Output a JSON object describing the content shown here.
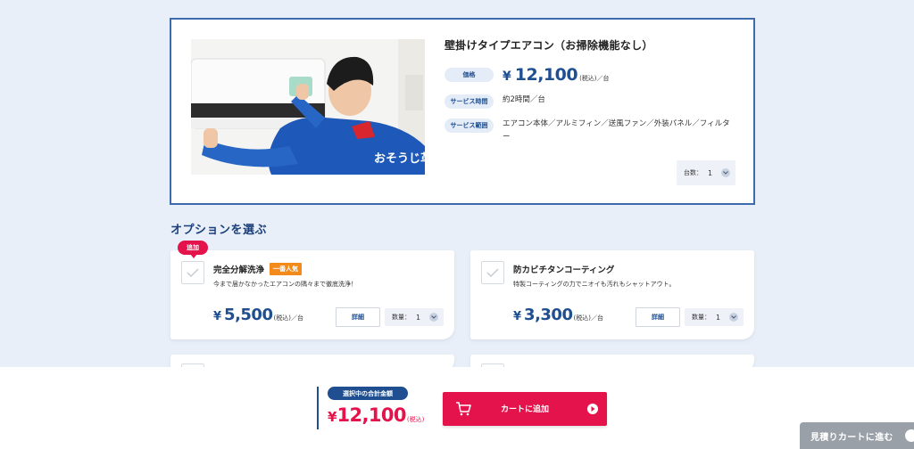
{
  "product": {
    "title": "壁掛けタイプエアコン（お掃除機能なし）",
    "price_label": "価格",
    "price_yen": "¥",
    "price_value": "12,100",
    "price_suffix": "(税込)／台",
    "time_label": "サービス時間",
    "time_value": "約2時間／台",
    "scope_label": "サービス範囲",
    "scope_value": "エアコン本体／アルミフィン／送風ファン／外装パネル／フィルター",
    "qty_label": "台数：",
    "qty_value": "1",
    "photo_text": "おそうじ革命"
  },
  "options_title": "オプションを選ぶ",
  "add_tag": "追加",
  "options": [
    {
      "name": "完全分解洗浄",
      "badge": "一番人気",
      "desc": "今まで届かなかったエアコンの隅々まで徹底洗浄！",
      "yen": "¥",
      "price": "5,500",
      "suffix": "(税込)／台",
      "detail": "詳細",
      "qty_label": "数量：",
      "qty_value": "1"
    },
    {
      "name": "防カビチタンコーティング",
      "desc": "特製コーティングの力でニオイも汚れもシャットアウト。",
      "yen": "¥",
      "price": "3,300",
      "suffix": "(税込)／台",
      "detail": "詳細",
      "qty_label": "数量：",
      "qty_value": "1"
    }
  ],
  "bottom": {
    "total_label": "選択中の合計金額",
    "total_yen": "¥",
    "total_value": "12,100",
    "total_suffix": "(税込)",
    "cart_label": "カートに追加",
    "estimate_label": "見積りカートに進む"
  },
  "colors": {
    "brand_blue": "#1f4f91",
    "accent_red": "#e5134b",
    "badge_orange": "#f28a1c",
    "page_bg": "#e9eff8"
  }
}
